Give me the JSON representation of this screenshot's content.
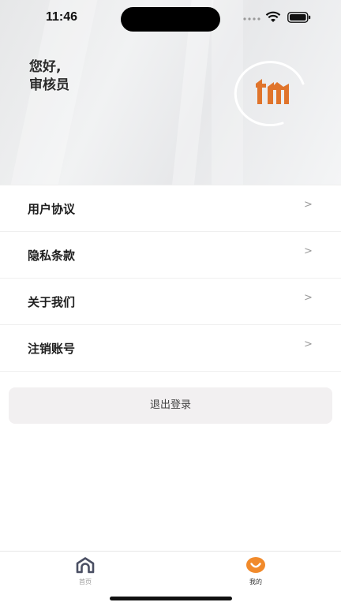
{
  "status_bar": {
    "time": "11:46"
  },
  "header": {
    "greeting_line1": "您好,",
    "greeting_line2": "审核员",
    "logo_icon": "tm-logo",
    "logo_color": "#e0742b"
  },
  "menu": {
    "items": [
      {
        "label": "用户协议",
        "icon": "chevron-right-icon"
      },
      {
        "label": "隐私条款",
        "icon": "chevron-right-icon"
      },
      {
        "label": "关于我们",
        "icon": "chevron-right-icon"
      },
      {
        "label": "注销账号",
        "icon": "chevron-right-icon"
      }
    ]
  },
  "logout": {
    "label": "退出登录"
  },
  "tabbar": {
    "tabs": [
      {
        "label": "首页",
        "icon": "home-icon",
        "active": false
      },
      {
        "label": "我的",
        "icon": "smile-icon",
        "active": true
      }
    ],
    "active_color": "#f18a2b"
  }
}
